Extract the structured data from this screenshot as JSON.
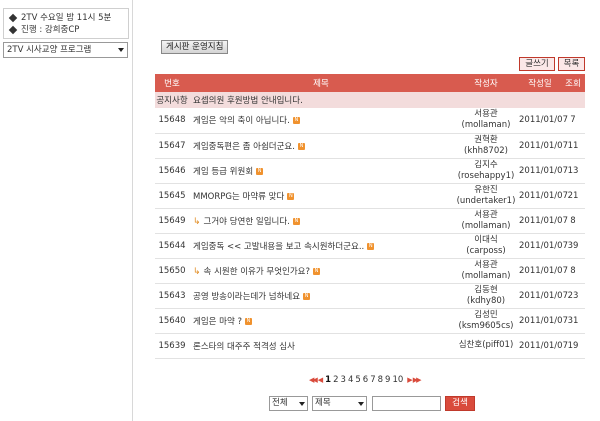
{
  "sidebar": {
    "info_lines": [
      "2TV 수요일 밤 11시 5분",
      "진행 : 강희중CP"
    ],
    "program_select": "2TV 시사교양 프로그램"
  },
  "board": {
    "guide_button": "게시판 운영지침",
    "write_button": "글쓰기",
    "list_button": "목록",
    "columns": [
      "번호",
      "제목",
      "작성자",
      "작성일",
      "조회"
    ],
    "notice": {
      "label": "공지사항",
      "title": "요셉의원 후원방법 안내입니다."
    },
    "rows": [
      {
        "num": "15648",
        "title": "게임은 악의 축이 아닙니다.",
        "author_name": "서용관",
        "author_id": "(mollaman)",
        "date": "2011/01/07",
        "views": "7"
      },
      {
        "num": "15647",
        "title": "게임중독편은 좀 아쉽더군요.",
        "author_name": "권혁환",
        "author_id": "(khh8702)",
        "date": "2011/01/07",
        "views": "11"
      },
      {
        "num": "15646",
        "title": "게임 등급 위원회",
        "author_name": "김지수",
        "author_id": "(rosehappy1)",
        "date": "2011/01/07",
        "views": "13"
      },
      {
        "num": "15645",
        "title": "MMORPG는 마약류 맞다",
        "author_name": "유한진",
        "author_id": "(undertaker1)",
        "date": "2011/01/07",
        "views": "21"
      },
      {
        "num": "15649",
        "title": "그거야 당연한 일입니다.",
        "author_name": "서용관",
        "author_id": "(mollaman)",
        "date": "2011/01/07",
        "views": "8"
      },
      {
        "num": "15644",
        "title": "게임중독 << 고발내용을 보고 속시원하더군요..",
        "author_name": "이대식",
        "author_id": "(carposs)",
        "date": "2011/01/07",
        "views": "39"
      },
      {
        "num": "15650",
        "title": "속 시원한 이유가 무엇인가요?",
        "author_name": "서용관",
        "author_id": "(mollaman)",
        "date": "2011/01/07",
        "views": "8"
      },
      {
        "num": "15643",
        "title": "공영 방송이라는데가 넘하네요",
        "author_name": "김동현",
        "author_id": "(kdhy80)",
        "date": "2011/01/07",
        "views": "23"
      },
      {
        "num": "15640",
        "title": "게임은 마약 ?",
        "author_name": "김성민",
        "author_id": "(ksm9605cs)",
        "date": "2011/01/07",
        "views": "31"
      },
      {
        "num": "15639",
        "title": "론스타의 대주주 적격성 심사",
        "author_name": "심찬호(piff01)",
        "author_id": "",
        "date": "2011/01/07",
        "views": "19"
      }
    ],
    "new_badge": "N",
    "reply_marker": "↳"
  },
  "pagination": {
    "first": "◀◀",
    "prev": "◀",
    "pages": [
      "1",
      "2",
      "3",
      "4",
      "5",
      "6",
      "7",
      "8",
      "9",
      "10"
    ],
    "current": "1",
    "next": "▶",
    "last": "▶▶"
  },
  "search": {
    "scope": "전체",
    "field": "제목",
    "query": "",
    "button": "검색"
  },
  "colors": {
    "header_red": "#d85b4f",
    "notice_pink": "#f3dcdc",
    "badge_orange": "#f0922e"
  }
}
